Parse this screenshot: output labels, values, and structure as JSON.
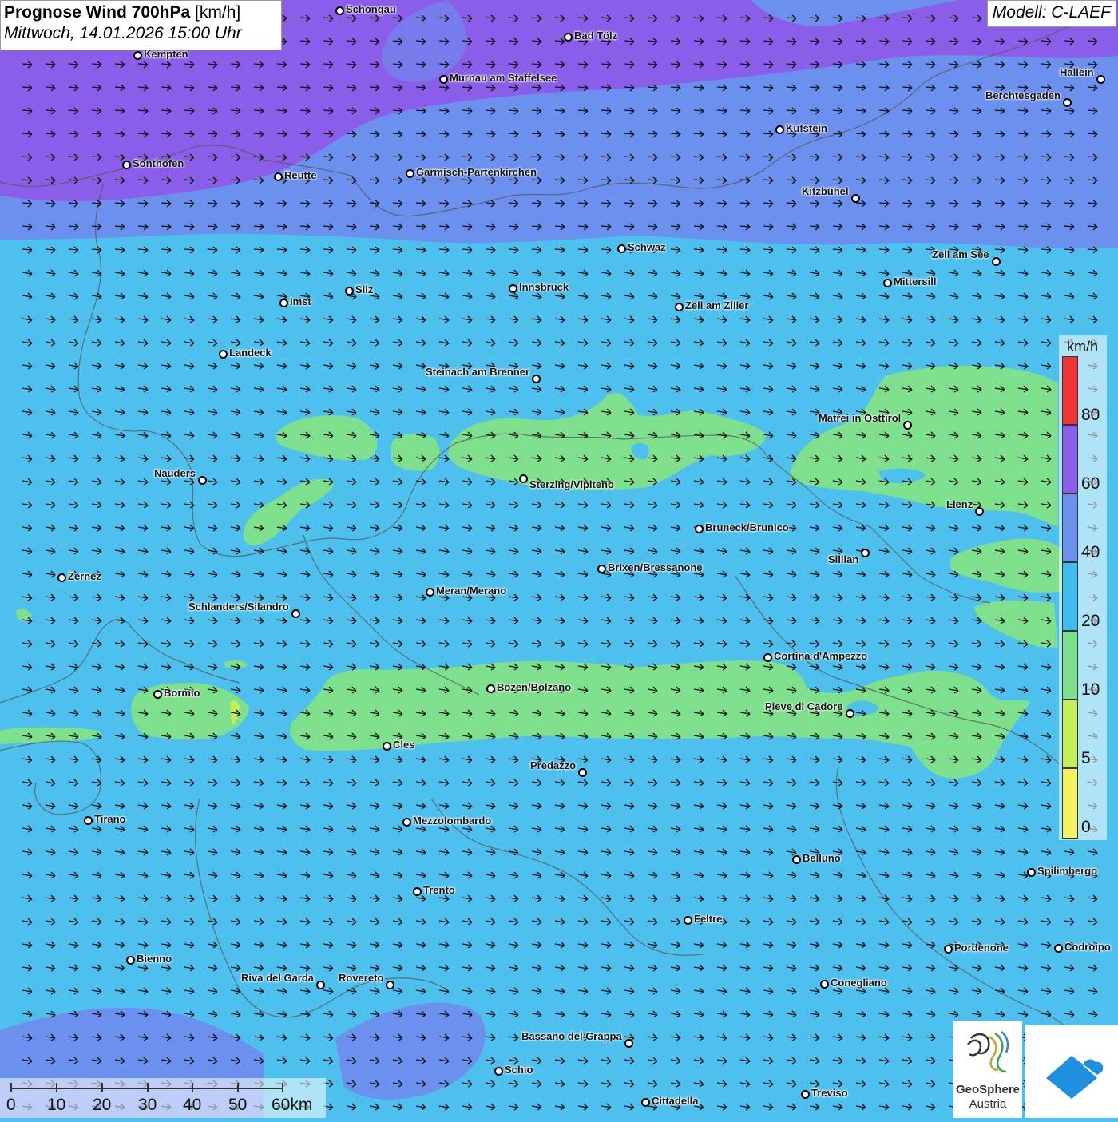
{
  "header": {
    "title_bold": "Prognose Wind 700hPa",
    "title_unit": "[km/h]",
    "subtitle": "Mittwoch, 14.01.2026 15:00 Uhr",
    "model": "Modell: C-LAEF"
  },
  "legend": {
    "unit": "km/h",
    "bands": [
      {
        "from": "80",
        "color": "#f03333"
      },
      {
        "from": "60",
        "color": "#8a5ee8"
      },
      {
        "from": "40",
        "color": "#6b90ee"
      },
      {
        "from": "20",
        "color": "#3fbdef"
      },
      {
        "from": "10",
        "color": "#7ee08c"
      },
      {
        "from": "5",
        "color": "#c3ef5a"
      },
      {
        "from": "0",
        "color": "#f4f261"
      }
    ],
    "ticks": [
      "80",
      "60",
      "40",
      "20",
      "10",
      "5",
      "0"
    ]
  },
  "scalebar": {
    "labels": [
      "0",
      "10",
      "20",
      "30",
      "40",
      "50",
      "60km"
    ]
  },
  "logo": {
    "name_line1": "GeoSphere",
    "name_line2": "Austria"
  },
  "cities": [
    {
      "name": "Schongau"
    },
    {
      "name": "Bad Tölz"
    },
    {
      "name": "Kempten"
    },
    {
      "name": "Murnau am Staffelsee"
    },
    {
      "name": "Hallein"
    },
    {
      "name": "Berchtesgaden"
    },
    {
      "name": "Kufstein"
    },
    {
      "name": "Sonthofen"
    },
    {
      "name": "Reutte"
    },
    {
      "name": "Garmisch-Partenkirchen"
    },
    {
      "name": "Kitzbühel"
    },
    {
      "name": "Schwaz"
    },
    {
      "name": "Zell am See"
    },
    {
      "name": "Mittersill"
    },
    {
      "name": "Innsbruck"
    },
    {
      "name": "Silz"
    },
    {
      "name": "Imst"
    },
    {
      "name": "Zell am Ziller"
    },
    {
      "name": "Landeck"
    },
    {
      "name": "Steinach am Brenner"
    },
    {
      "name": "Matrei in Osttirol"
    },
    {
      "name": "Nauders"
    },
    {
      "name": "Sterzing/Vipiteno"
    },
    {
      "name": "Lienz"
    },
    {
      "name": "Bruneck/Brunico"
    },
    {
      "name": "Sillian"
    },
    {
      "name": "Zernez"
    },
    {
      "name": "Brixen/Bressanone"
    },
    {
      "name": "Meran/Merano"
    },
    {
      "name": "Schlanders/Silandro"
    },
    {
      "name": "Cortina d'Ampezzo"
    },
    {
      "name": "Bozen/Bolzano"
    },
    {
      "name": "Bormio"
    },
    {
      "name": "Pieve di Cadore"
    },
    {
      "name": "Cles"
    },
    {
      "name": "Predazzo"
    },
    {
      "name": "Tirano"
    },
    {
      "name": "Mezzolombardo"
    },
    {
      "name": "Belluno"
    },
    {
      "name": "Spilimbergo"
    },
    {
      "name": "Trento"
    },
    {
      "name": "Feltre"
    },
    {
      "name": "Pordenone"
    },
    {
      "name": "Codroipo"
    },
    {
      "name": "Bienno"
    },
    {
      "name": "Riva del Garda"
    },
    {
      "name": "Rovereto"
    },
    {
      "name": "Conegliano"
    },
    {
      "name": "Bassano del Grappa"
    },
    {
      "name": "Schio"
    },
    {
      "name": "Treviso"
    },
    {
      "name": "Cittadella"
    }
  ],
  "colors": {
    "band_60": "#8a5ee8",
    "band_40": "#6b90ee",
    "band_20": "#3fbdef",
    "band_10": "#7ee08c",
    "band_5": "#c3ef5a"
  }
}
